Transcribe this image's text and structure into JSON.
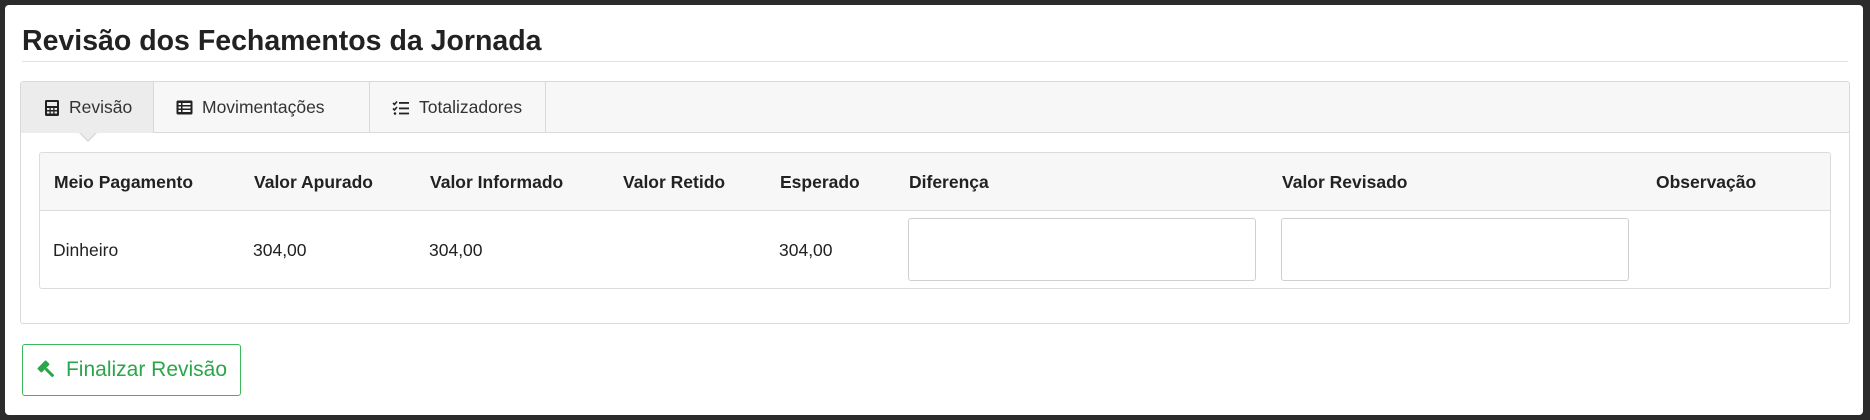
{
  "page": {
    "title": "Revisão dos Fechamentos da Jornada"
  },
  "tabs": [
    {
      "label": "Revisão",
      "icon": "calculator-icon",
      "active": true
    },
    {
      "label": "Movimentações",
      "icon": "list-icon",
      "active": false
    },
    {
      "label": "Totalizadores",
      "icon": "checklist-icon",
      "active": false
    }
  ],
  "table": {
    "columns": [
      "Meio Pagamento",
      "Valor Apurado",
      "Valor Informado",
      "Valor Retido",
      "Esperado",
      "Diferença",
      "Valor Revisado",
      "Observação"
    ],
    "rows": [
      {
        "meio_pagamento": "Dinheiro",
        "valor_apurado": "304,00",
        "valor_informado": "304,00",
        "valor_retido": "",
        "esperado": "304,00",
        "diferenca": "",
        "valor_revisado": "",
        "observacao": ""
      }
    ]
  },
  "actions": {
    "finish_label": "Finalizar Revisão",
    "finish_icon": "gavel-icon"
  },
  "colors": {
    "success": "#2aa64a",
    "border": "#d9d9d9",
    "header_bg": "#f7f7f7"
  }
}
